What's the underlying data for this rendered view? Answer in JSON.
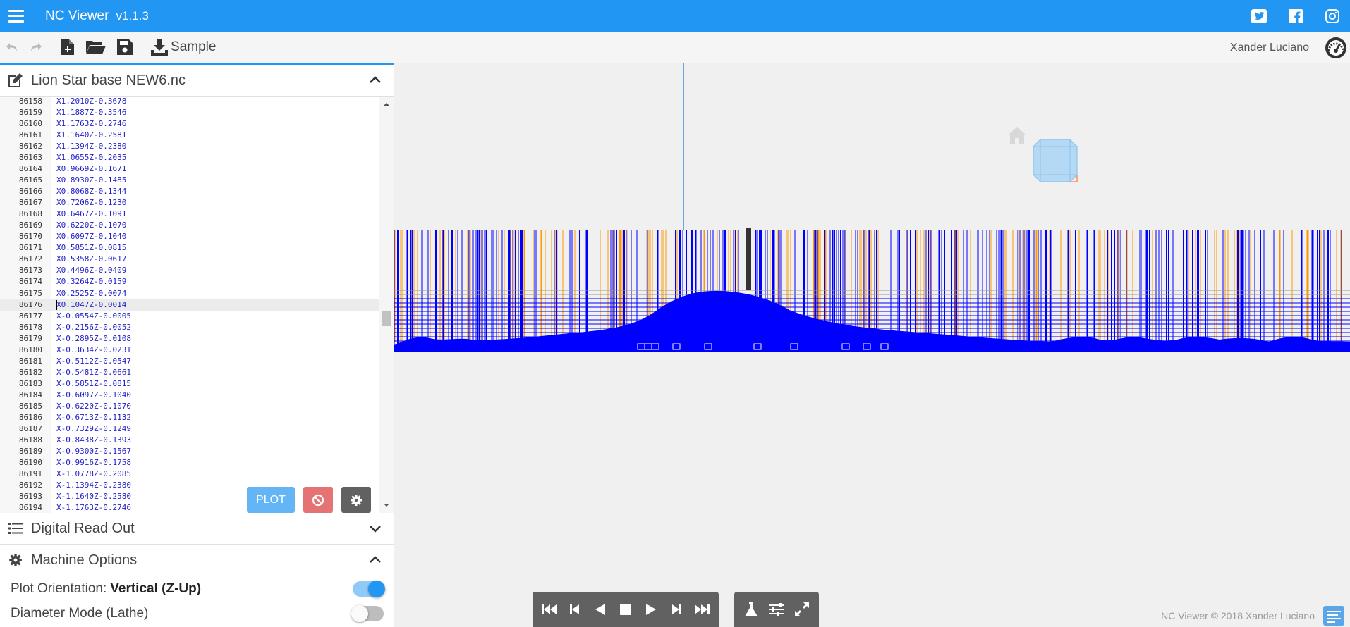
{
  "app": {
    "title": "NC Viewer",
    "version": "v1.1.3"
  },
  "social": {
    "twitter": "twitter-icon",
    "facebook": "facebook-icon",
    "instagram": "instagram-icon"
  },
  "toolbar": {
    "sample_label": "Sample",
    "user": "Xander Luciano"
  },
  "editor": {
    "filename": "Lion Star base NEW6.nc",
    "active_line": 86176,
    "lines": [
      {
        "n": "86158",
        "code": "X1.2010Z-0.3678"
      },
      {
        "n": "86159",
        "code": "X1.1887Z-0.3546"
      },
      {
        "n": "86160",
        "code": "X1.1763Z-0.2746"
      },
      {
        "n": "86161",
        "code": "X1.1640Z-0.2581"
      },
      {
        "n": "86162",
        "code": "X1.1394Z-0.2380"
      },
      {
        "n": "86163",
        "code": "X1.0655Z-0.2035"
      },
      {
        "n": "86164",
        "code": "X0.9669Z-0.1671"
      },
      {
        "n": "86165",
        "code": "X0.8930Z-0.1485"
      },
      {
        "n": "86166",
        "code": "X0.8068Z-0.1344"
      },
      {
        "n": "86167",
        "code": "X0.7206Z-0.1230"
      },
      {
        "n": "86168",
        "code": "X0.6467Z-0.1091"
      },
      {
        "n": "86169",
        "code": "X0.6220Z-0.1070"
      },
      {
        "n": "86170",
        "code": "X0.6097Z-0.1040"
      },
      {
        "n": "86171",
        "code": "X0.5851Z-0.0815"
      },
      {
        "n": "86172",
        "code": "X0.5358Z-0.0617"
      },
      {
        "n": "86173",
        "code": "X0.4496Z-0.0409"
      },
      {
        "n": "86174",
        "code": "X0.3264Z-0.0159"
      },
      {
        "n": "86175",
        "code": "X0.2525Z-0.0074"
      },
      {
        "n": "86176",
        "code": "X0.1047Z-0.0014"
      },
      {
        "n": "86177",
        "code": "X-0.0554Z-0.0005"
      },
      {
        "n": "86178",
        "code": "X-0.2156Z-0.0052"
      },
      {
        "n": "86179",
        "code": "X-0.2895Z-0.0108"
      },
      {
        "n": "86180",
        "code": "X-0.3634Z-0.0231"
      },
      {
        "n": "86181",
        "code": "X-0.5112Z-0.0547"
      },
      {
        "n": "86182",
        "code": "X-0.5481Z-0.0661"
      },
      {
        "n": "86183",
        "code": "X-0.5851Z-0.0815"
      },
      {
        "n": "86184",
        "code": "X-0.6097Z-0.1040"
      },
      {
        "n": "86185",
        "code": "X-0.6220Z-0.1070"
      },
      {
        "n": "86186",
        "code": "X-0.6713Z-0.1132"
      },
      {
        "n": "86187",
        "code": "X-0.7329Z-0.1249"
      },
      {
        "n": "86188",
        "code": "X-0.8438Z-0.1393"
      },
      {
        "n": "86189",
        "code": "X-0.9300Z-0.1567"
      },
      {
        "n": "86190",
        "code": "X-0.9916Z-0.1758"
      },
      {
        "n": "86191",
        "code": "X-1.0778Z-0.2085"
      },
      {
        "n": "86192",
        "code": "X-1.1394Z-0.2380"
      },
      {
        "n": "86193",
        "code": "X-1.1640Z-0.2580"
      },
      {
        "n": "86194",
        "code": "X-1.1763Z-0.2746"
      }
    ],
    "plot_label": "PLOT"
  },
  "panels": {
    "dro": "Digital Read Out",
    "machine": "Machine Options"
  },
  "options": {
    "orientation_label": "Plot Orientation:",
    "orientation_value": "Vertical (Z-Up)",
    "orientation_on": true,
    "diameter_label": "Diameter Mode (Lathe)",
    "diameter_on": false
  },
  "footer": {
    "copyright": "NC Viewer © 2018 Xander Luciano"
  },
  "colors": {
    "primary": "#2196f3",
    "rapid": "#ff9800",
    "feed": "#0000ff",
    "code_text": "#1e1ec8"
  }
}
